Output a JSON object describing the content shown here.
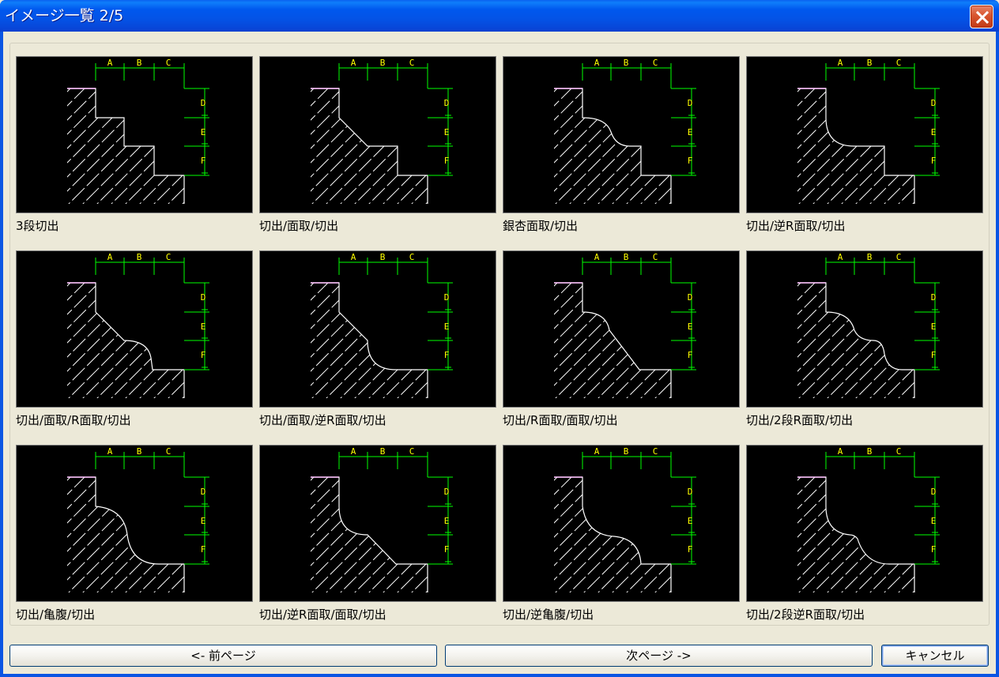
{
  "window": {
    "title": "イメージ一覧  2/5",
    "close_icon": "close-icon"
  },
  "thumbnails": [
    {
      "caption": "3段切出",
      "profile": "steps3"
    },
    {
      "caption": "切出/面取/切出",
      "profile": "chamfer"
    },
    {
      "caption": "銀杏面取/切出",
      "profile": "ginkgo"
    },
    {
      "caption": "切出/逆R面取/切出",
      "profile": "revR"
    },
    {
      "caption": "切出/面取/R面取/切出",
      "profile": "chamferR"
    },
    {
      "caption": "切出/面取/逆R面取/切出",
      "profile": "chamferRevR"
    },
    {
      "caption": "切出/R面取/面取/切出",
      "profile": "RChamfer"
    },
    {
      "caption": "切出/2段R面取/切出",
      "profile": "twoR"
    },
    {
      "caption": "切出/亀腹/切出",
      "profile": "kamebara"
    },
    {
      "caption": "切出/逆R面取/面取/切出",
      "profile": "revRChamfer"
    },
    {
      "caption": "切出/逆亀腹/切出",
      "profile": "revKamebara"
    },
    {
      "caption": "切出/2段逆R面取/切出",
      "profile": "twoRevR"
    }
  ],
  "dimension_labels": {
    "top": [
      "A",
      "B",
      "C"
    ],
    "right": [
      "D",
      "E",
      "F"
    ]
  },
  "buttons": {
    "prev": "<- 前ページ",
    "next": "次ページ ->",
    "cancel": "キャンセル"
  },
  "colors": {
    "title_bar": "#0453e6",
    "dimension_line": "#00ff00",
    "dimension_label": "#ffff00",
    "reference_line": "#ff00ff",
    "profile_line": "#ffffff"
  }
}
